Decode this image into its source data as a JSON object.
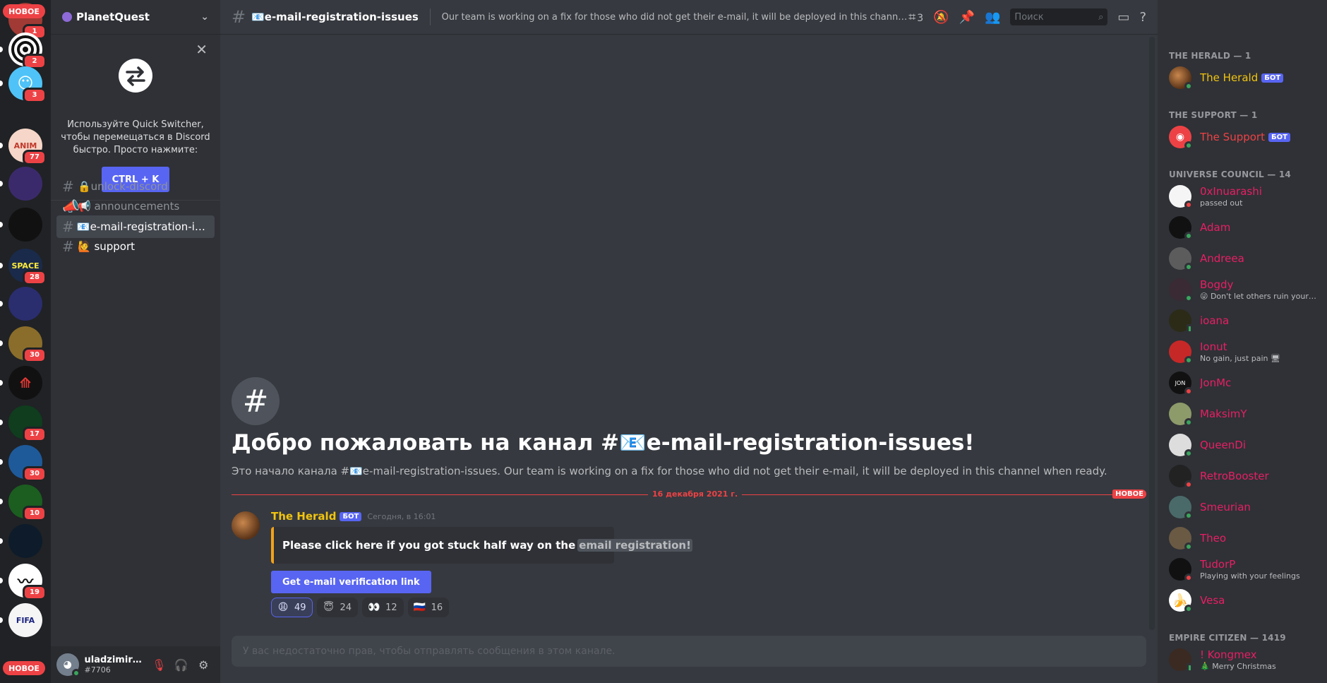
{
  "servers": {
    "new_label": "НОВОЕ",
    "items": [
      {
        "badge": "1"
      },
      {
        "badge": "2"
      },
      {
        "badge": "3"
      },
      {
        "badge": "77"
      },
      {
        "badge": ""
      },
      {
        "badge": ""
      },
      {
        "badge": "28"
      },
      {
        "badge": ""
      },
      {
        "badge": "30"
      },
      {
        "badge": ""
      },
      {
        "badge": "17"
      },
      {
        "badge": "30"
      },
      {
        "badge": "10"
      },
      {
        "badge": ""
      },
      {
        "badge": "19"
      },
      {
        "badge": ""
      }
    ]
  },
  "guild": {
    "name": "PlanetQuest"
  },
  "quick_switcher": {
    "text": "Используйте Quick Switcher, чтобы перемещаться в Discord быстро. Просто нажмите:",
    "button": "CTRL + K"
  },
  "channels": [
    {
      "label": "🔒unlock-discord"
    },
    {
      "label": "📢 announcements"
    },
    {
      "label": "📧e-mail-registration-iss..."
    },
    {
      "label": "🙋 support"
    }
  ],
  "user": {
    "name": "uladzimir19...",
    "tag": "#7706"
  },
  "topbar": {
    "channel": "📧e-mail-registration-issues",
    "topic": "Our team is working on a fix for those who did not get their e-mail, it will be deployed in this channel when ready.",
    "threads_count": "3",
    "search_placeholder": "Поиск"
  },
  "welcome": {
    "title": "Добро пожаловать на канал #📧e-mail-registration-issues!",
    "subtitle": "Это начало канала #📧e-mail-registration-issues. Our team is working on a fix for those who did not get their e-mail, it will be deployed in this channel when ready."
  },
  "divider": {
    "date": "16 декабря 2021 г.",
    "new": "НОВОЕ"
  },
  "message": {
    "author": "The Herald",
    "bot_tag": "БОТ",
    "timestamp": "Сегодня, в 16:01",
    "embed_text": "Please click here if you got stuck half way on the",
    "embed_spoiler": "email registration!",
    "button": "Get e-mail verification link",
    "reactions": [
      {
        "emoji": "😩",
        "count": "49"
      },
      {
        "emoji": "😇",
        "count": "24"
      },
      {
        "emoji": "👀",
        "count": "12"
      },
      {
        "emoji": "🇷🇺",
        "count": "16"
      }
    ]
  },
  "composer": {
    "placeholder": "У вас недостаточно прав, чтобы отправлять сообщения в этом канале."
  },
  "members": {
    "groups": [
      {
        "title": "THE HERALD — 1"
      },
      {
        "title": "THE SUPPORT — 1"
      },
      {
        "title": "UNIVERSE COUNCIL — 14"
      },
      {
        "title": "EMPIRE CITIZEN — 1419"
      }
    ],
    "list": [
      {
        "name": "The Herald",
        "status": "",
        "bot": "БОТ",
        "color": "#f1c40f"
      },
      {
        "name": "The Support",
        "status": "",
        "bot": "БОТ",
        "color": "#ed4245"
      },
      {
        "name": "0xInuarashi",
        "status": "passed out",
        "color": "#e91e63"
      },
      {
        "name": "Adam",
        "status": "",
        "color": "#e91e63"
      },
      {
        "name": "Andreea",
        "status": "",
        "color": "#e91e63"
      },
      {
        "name": "Bogdy",
        "status": "😜 Don't let others ruin your d...",
        "color": "#e91e63"
      },
      {
        "name": "ioana",
        "status": "",
        "color": "#e91e63"
      },
      {
        "name": "Ionut",
        "status": "No gain, just pain 🖥",
        "color": "#e91e63"
      },
      {
        "name": "JonMc",
        "status": "",
        "color": "#e91e63"
      },
      {
        "name": "MaksimY",
        "status": "",
        "color": "#e91e63"
      },
      {
        "name": "QueenDi",
        "status": "",
        "color": "#e91e63"
      },
      {
        "name": "RetroBooster",
        "status": "",
        "color": "#e91e63"
      },
      {
        "name": "Smeurian",
        "status": "",
        "color": "#e91e63"
      },
      {
        "name": "Theo",
        "status": "",
        "color": "#e91e63"
      },
      {
        "name": "TudorP",
        "status": "Playing with your feelings",
        "color": "#e91e63"
      },
      {
        "name": "Vesa",
        "status": "",
        "color": "#e91e63"
      },
      {
        "name": "! Kongmex",
        "status": "🎄 Merry Christmas",
        "color": "#e91e63"
      }
    ]
  }
}
